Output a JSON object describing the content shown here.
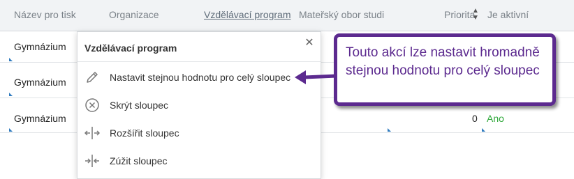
{
  "columns": [
    {
      "label": "Název pro tisk"
    },
    {
      "label": "Organizace"
    },
    {
      "label": "Vzdělávací program"
    },
    {
      "label": "Mateřský obor studi"
    },
    {
      "label": "Priorita"
    },
    {
      "label": "Je aktivní"
    }
  ],
  "rows": [
    {
      "name": "Gymnázium"
    },
    {
      "name": "Gymnázium"
    },
    {
      "name": "Gymnázium",
      "priority": "0",
      "active": "Ano"
    }
  ],
  "menu": {
    "title": "Vzdělávací program",
    "items": [
      {
        "label": "Nastavit stejnou hodnotu pro celý sloupec",
        "icon": "pencil-icon"
      },
      {
        "label": "Skrýt sloupec",
        "icon": "hide-circle-x-icon"
      },
      {
        "label": "Rozšířit sloupec",
        "icon": "expand-column-icon"
      },
      {
        "label": "Zúžit sloupec",
        "icon": "shrink-column-icon"
      }
    ]
  },
  "callout": {
    "text": "Touto akcí lze nastavit hromadně stejnou hodnotu pro celý sloupec"
  },
  "colors": {
    "callout_border": "#5c2a8f",
    "active_green": "#2fa83a",
    "row_marker": "#2f7bbf"
  }
}
